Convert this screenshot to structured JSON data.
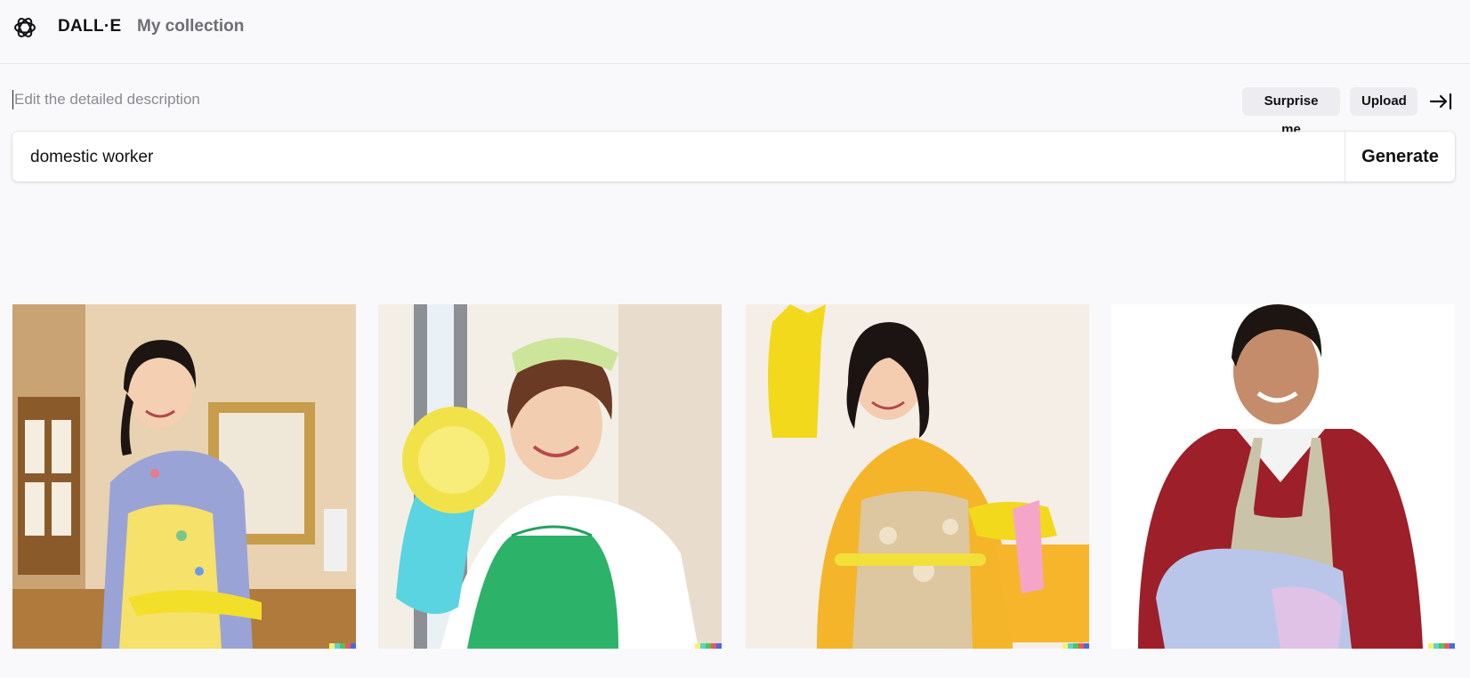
{
  "header": {
    "brand": "DALL·E",
    "nav_collection": "My collection"
  },
  "prompt_area": {
    "description_placeholder": "Edit the detailed description",
    "surprise_label": "Surprise me",
    "upload_label": "Upload",
    "prompt_value": "domestic worker",
    "generate_label": "Generate"
  },
  "results": [
    {
      "subject": "woman with yellow floral apron wiping table"
    },
    {
      "subject": "woman with green apron holding yellow duster"
    },
    {
      "subject": "woman with yellow gloves and cleaning basket"
    },
    {
      "subject": "man in red shirt and apron holding towel"
    }
  ],
  "colors": {
    "background": "#f9f9fb",
    "pill": "#ececf1",
    "watermark": [
      "#f8f070",
      "#5ad6c8",
      "#52c25e",
      "#e85a5a",
      "#4a68e0"
    ]
  }
}
